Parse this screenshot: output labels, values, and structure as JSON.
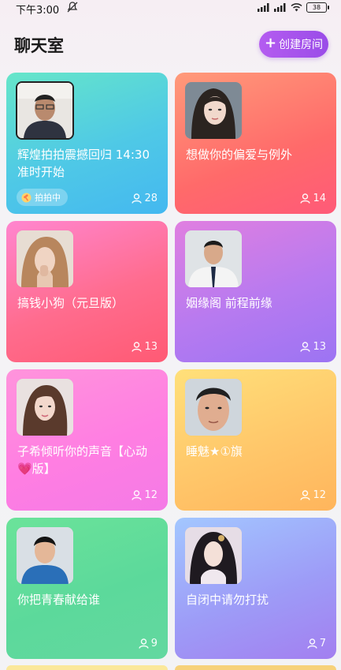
{
  "status": {
    "time": "下午3:00",
    "battery": "38"
  },
  "header": {
    "title": "聊天室",
    "create_label": "创建房间"
  },
  "rooms": [
    {
      "title": "辉煌拍拍震撼回归 14:30准时开始",
      "count": "28",
      "badge": "拍拍中"
    },
    {
      "title": "想做你的偏爱与例外",
      "count": "14"
    },
    {
      "title": "搞钱小狗（元旦版）",
      "count": "13"
    },
    {
      "title": "姻缘阁 前程前缘",
      "count": "13"
    },
    {
      "title": "子希倾听你的声音【心动💗版】",
      "count": "12"
    },
    {
      "title": "睡魅★①旗",
      "count": "12"
    },
    {
      "title": "你把青春献给谁",
      "count": "9"
    },
    {
      "title": "自闭中请勿打扰",
      "count": "7"
    }
  ]
}
